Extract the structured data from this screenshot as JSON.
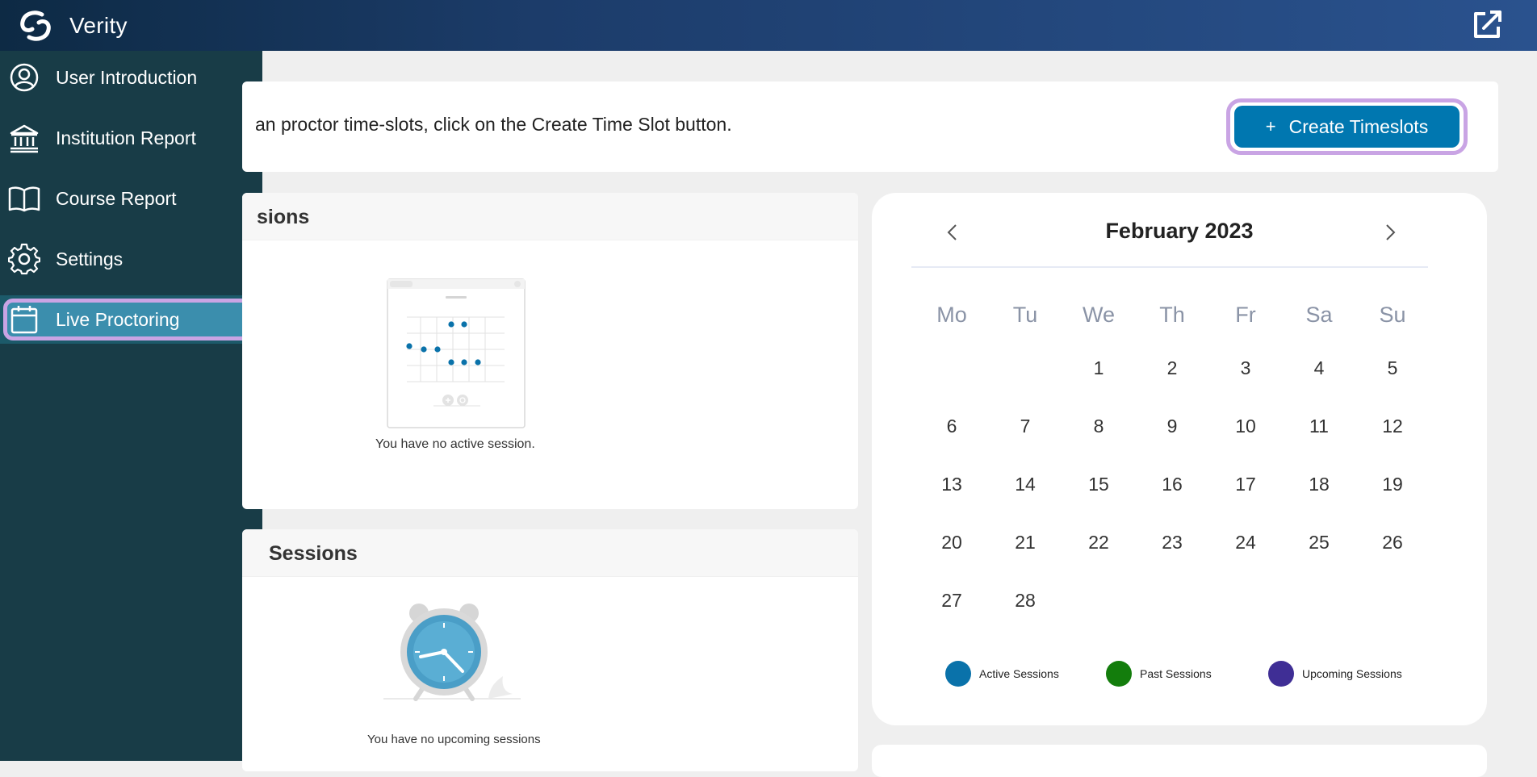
{
  "app": {
    "name": "Verity"
  },
  "sidebar": {
    "items": [
      {
        "label": "User Introduction",
        "icon": "user-circle-icon",
        "active": false
      },
      {
        "label": "Institution Report",
        "icon": "institution-icon",
        "active": false
      },
      {
        "label": "Course Report",
        "icon": "book-icon",
        "active": false
      },
      {
        "label": "Settings",
        "icon": "gear-icon",
        "active": false
      },
      {
        "label": "Live Proctoring",
        "icon": "calendar-icon",
        "active": true
      }
    ]
  },
  "info": {
    "text": "an proctor time-slots, click on the Create Time Slot button.",
    "create_button": {
      "icon": "+",
      "label": "Create Timeslots"
    }
  },
  "active_panel": {
    "title": "sions",
    "empty_text": "You have no active session."
  },
  "upcoming_panel": {
    "title": "Sessions",
    "empty_text": "You have no upcoming sessions"
  },
  "calendar": {
    "month_label": "February 2023",
    "weekdays": [
      "Mo",
      "Tu",
      "We",
      "Th",
      "Fr",
      "Sa",
      "Su"
    ],
    "first_weekday_index": 2,
    "days_in_month": 28,
    "legend": [
      {
        "label": "Active Sessions",
        "color": "#0a72aa"
      },
      {
        "label": "Past Sessions",
        "color": "#137d0c"
      },
      {
        "label": "Upcoming Sessions",
        "color": "#3f2e95"
      }
    ]
  },
  "colors": {
    "accent": "#0077b0",
    "sidebar_bg": "#183c47",
    "active_item": "#3b8ead",
    "highlight_ring": "#c9a4e4"
  }
}
